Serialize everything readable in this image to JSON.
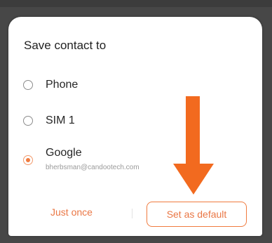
{
  "dialog": {
    "title": "Save contact to",
    "options": [
      {
        "label": "Phone",
        "selected": false
      },
      {
        "label": "SIM 1",
        "selected": false
      },
      {
        "label": "Google",
        "sublabel": "bherbsman@candootech.com",
        "selected": true
      }
    ],
    "buttons": {
      "once_label": "Just once",
      "default_label": "Set as default"
    }
  },
  "colors": {
    "accent": "#f07b3f",
    "arrow": "#f26a1f",
    "background_dim": "#474747",
    "dialog": "#ffffff"
  },
  "icons": {
    "annotation": "down-arrow-icon"
  }
}
